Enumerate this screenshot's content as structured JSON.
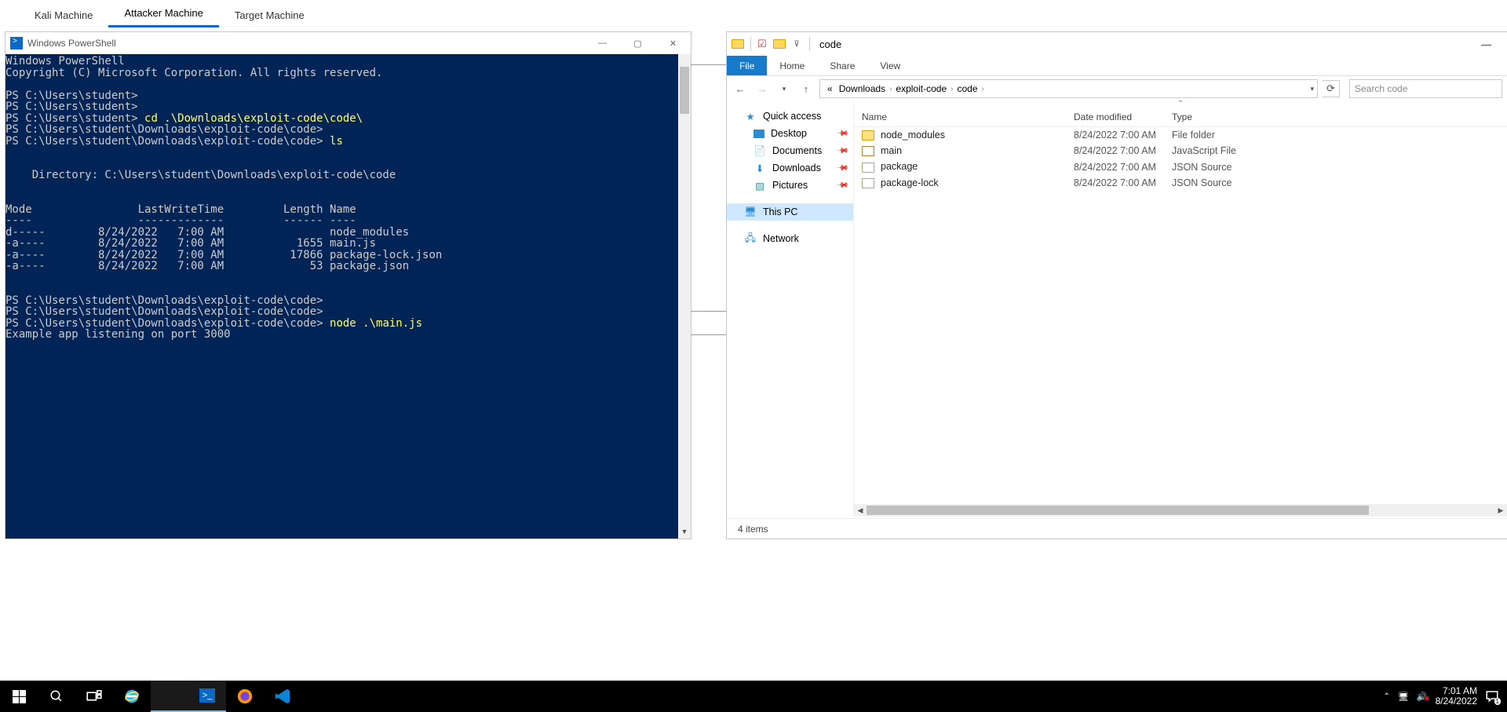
{
  "vm_tabs": [
    "Kali Machine",
    "Attacker Machine",
    "Target Machine"
  ],
  "vm_tabs_active": 1,
  "powershell": {
    "title": "Windows PowerShell",
    "lines_plain_pre": "Windows PowerShell\nCopyright (C) Microsoft Corporation. All rights reserved.\n\nPS C:\\Users\\student>\nPS C:\\Users\\student>\nPS C:\\Users\\student> ",
    "cmd1": "cd .\\Downloads\\exploit-code\\code\\",
    "lines_mid": "\nPS C:\\Users\\student\\Downloads\\exploit-code\\code>\nPS C:\\Users\\student\\Downloads\\exploit-code\\code> ",
    "cmd2": "ls",
    "dir_block": "\n\n\n    Directory: C:\\Users\\student\\Downloads\\exploit-code\\code\n\n\nMode                LastWriteTime         Length Name\n----                -------------         ------ ----\nd-----        8/24/2022   7:00 AM                node_modules\n-a----        8/24/2022   7:00 AM           1655 main.js\n-a----        8/24/2022   7:00 AM          17866 package-lock.json\n-a----        8/24/2022   7:00 AM             53 package.json\n\n\nPS C:\\Users\\student\\Downloads\\exploit-code\\code>\nPS C:\\Users\\student\\Downloads\\exploit-code\\code>\nPS C:\\Users\\student\\Downloads\\exploit-code\\code> ",
    "cmd3": "node .\\main.js",
    "out_line": "\nExample app listening on port 3000"
  },
  "explorer": {
    "title": "code",
    "ribbon": [
      "File",
      "Home",
      "Share",
      "View"
    ],
    "breadcrumb": [
      "Downloads",
      "exploit-code",
      "code"
    ],
    "breadcrumb_prefix": "«",
    "search_placeholder": "Search code",
    "nav": {
      "quick_access": "Quick access",
      "quick_items": [
        {
          "label": "Desktop",
          "pinned": true
        },
        {
          "label": "Documents",
          "pinned": true
        },
        {
          "label": "Downloads",
          "pinned": true
        },
        {
          "label": "Pictures",
          "pinned": true
        }
      ],
      "this_pc": "This PC",
      "network": "Network"
    },
    "columns": [
      "Name",
      "Date modified",
      "Type"
    ],
    "files": [
      {
        "name": "node_modules",
        "date": "8/24/2022 7:00 AM",
        "type": "File folder",
        "icon": "folder"
      },
      {
        "name": "main",
        "date": "8/24/2022 7:00 AM",
        "type": "JavaScript File",
        "icon": "js"
      },
      {
        "name": "package",
        "date": "8/24/2022 7:00 AM",
        "type": "JSON Source",
        "icon": "json"
      },
      {
        "name": "package-lock",
        "date": "8/24/2022 7:00 AM",
        "type": "JSON Source",
        "icon": "json"
      }
    ],
    "status": "4 items"
  },
  "taskbar": {
    "time": "7:01 AM",
    "date": "8/24/2022"
  }
}
